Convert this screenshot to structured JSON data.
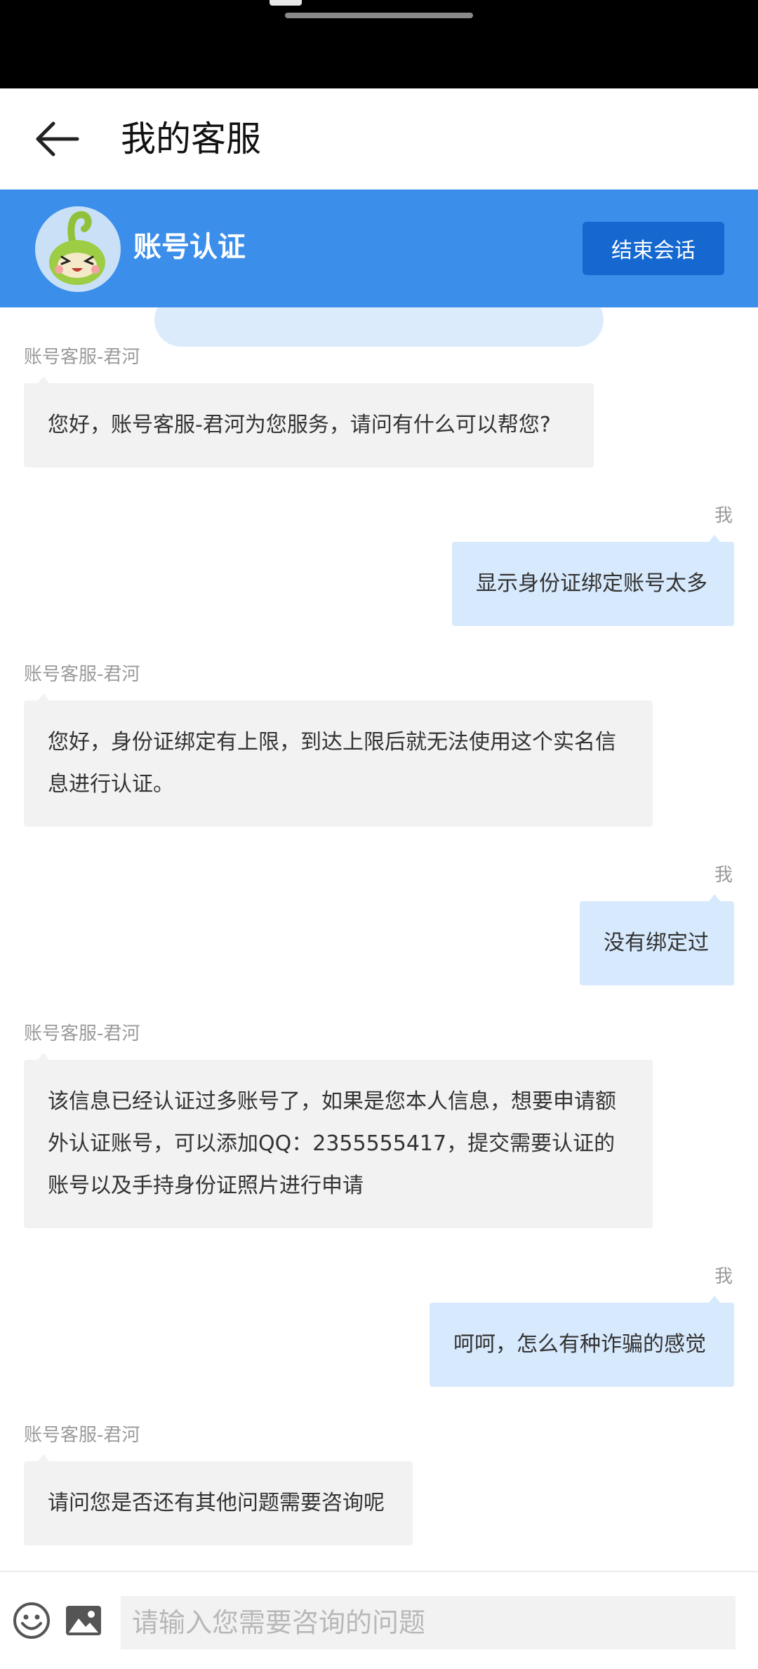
{
  "header": {
    "title": "我的客服"
  },
  "session": {
    "title": "账号认证",
    "end_label": "结束会话"
  },
  "messages": [
    {
      "from": "agent",
      "sender": "账号客服-君河",
      "text": "您好，账号客服-君河为您服务，请问有什么可以帮您?"
    },
    {
      "from": "me",
      "sender": "我",
      "text": "显示身份证绑定账号太多"
    },
    {
      "from": "agent",
      "sender": "账号客服-君河",
      "text": "您好，身份证绑定有上限，到达上限后就无法使用这个实名信息进行认证。"
    },
    {
      "from": "me",
      "sender": "我",
      "text": "没有绑定过"
    },
    {
      "from": "agent",
      "sender": "账号客服-君河",
      "text": "该信息已经认证过多账号了，如果是您本人信息，想要申请额外认证账号，可以添加QQ：2355555417，提交需要认证的账号以及手持身份证照片进行申请"
    },
    {
      "from": "me",
      "sender": "我",
      "text": "呵呵，怎么有种诈骗的感觉"
    },
    {
      "from": "agent",
      "sender": "账号客服-君河",
      "text": "请问您是否还有其他问题需要咨询呢"
    }
  ],
  "input": {
    "placeholder": "请输入您需要咨询的问题",
    "value": ""
  },
  "icons": {
    "back": "arrow-left-icon",
    "emoji": "smiley-icon",
    "image": "image-icon"
  },
  "colors": {
    "accent": "#3b8eea",
    "button": "#1468cf",
    "my_bubble": "#d7e9fc",
    "agent_bubble": "#f2f2f2"
  }
}
